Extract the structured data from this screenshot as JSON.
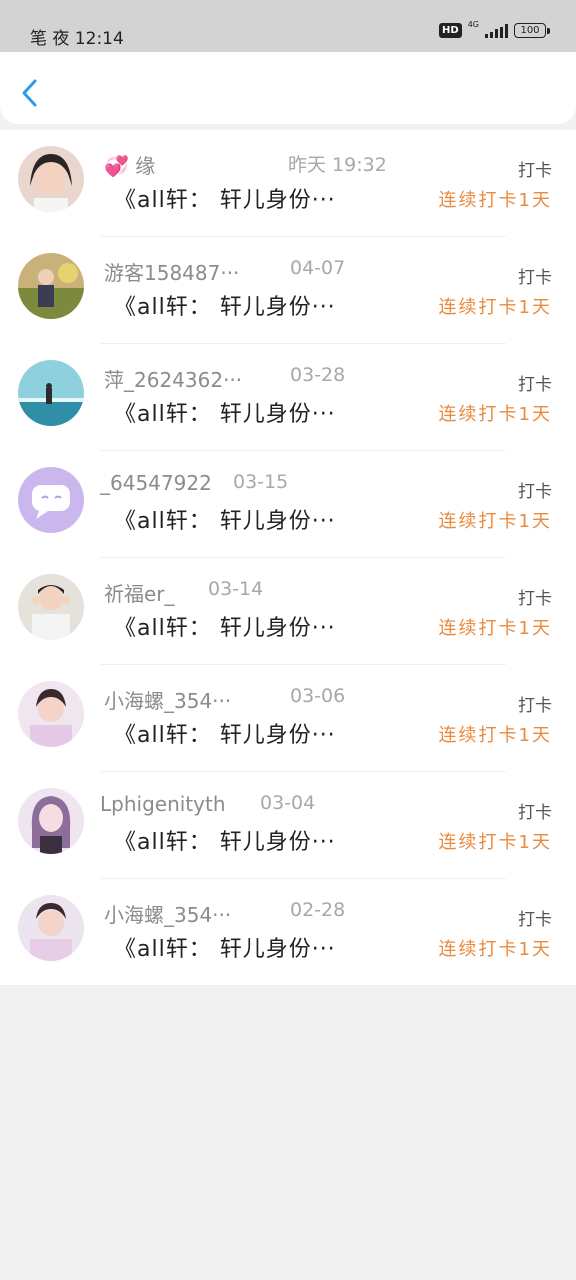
{
  "status_bar": {
    "time": "笔 夜 12:14",
    "hd": "HD",
    "network": "4G",
    "battery": "100"
  },
  "header": {
    "back_icon": "chevron-left-icon",
    "accent_color": "#2f9be6"
  },
  "rows": [
    {
      "name": "💞 缘 ",
      "date": "昨天 19:32",
      "message": "《all轩： 轩儿身份···",
      "checkin": "打卡",
      "streak": "连续打卡1天"
    },
    {
      "name": "游客158487···",
      "date": "04-07",
      "message": "《all轩： 轩儿身份···",
      "checkin": "打卡",
      "streak": "连续打卡1天"
    },
    {
      "name": "萍_2624362···",
      "date": "03-28",
      "message": "《all轩： 轩儿身份···",
      "checkin": "打卡",
      "streak": "连续打卡1天"
    },
    {
      "name": "_64547922",
      "date": "03-15",
      "message": "《all轩： 轩儿身份···",
      "checkin": "打卡",
      "streak": "连续打卡1天"
    },
    {
      "name": "祈福er_",
      "date": "03-14",
      "message": "《all轩： 轩儿身份···",
      "checkin": "打卡",
      "streak": "连续打卡1天"
    },
    {
      "name": "小海螺_354···",
      "date": "03-06",
      "message": "《all轩： 轩儿身份···",
      "checkin": "打卡",
      "streak": "连续打卡1天"
    },
    {
      "name": "Lphigenityth",
      "date": "03-04",
      "message": "《all轩： 轩儿身份···",
      "checkin": "打卡",
      "streak": "连续打卡1天"
    },
    {
      "name": "小海螺_354···",
      "date": "02-28",
      "message": "《all轩： 轩儿身份···",
      "checkin": "打卡",
      "streak": "连续打卡1天"
    }
  ]
}
